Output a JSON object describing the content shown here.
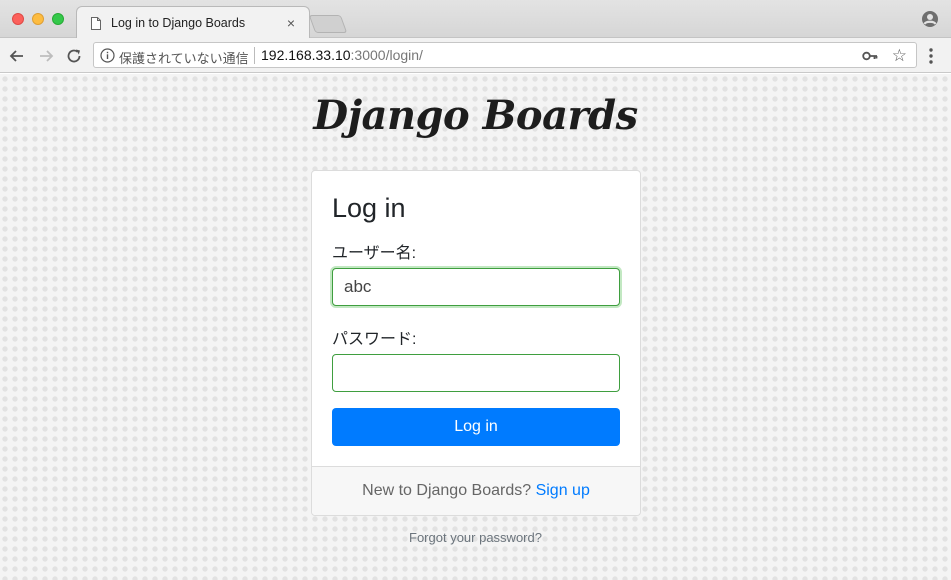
{
  "browser": {
    "tab_title": "Log in to Django Boards",
    "tab_close": "×",
    "security_text": "保護されていない通信",
    "url_host": "192.168.33.10",
    "url_rest": ":3000/login/",
    "star_glyph": "☆",
    "icons": [
      "back-icon",
      "forward-icon",
      "reload-icon",
      "info-icon",
      "key-icon",
      "star-icon",
      "menu-icon",
      "profile-icon",
      "document-icon"
    ]
  },
  "page": {
    "brand": "Django Boards",
    "form": {
      "title": "Log in",
      "username_label": "ユーザー名:",
      "username_value": "abc",
      "password_label": "パスワード:",
      "password_value": "",
      "submit_label": "Log in"
    },
    "footer": {
      "prompt": "New to Django Boards?",
      "signup_label": "Sign up"
    },
    "forgot_label": "Forgot your password?"
  },
  "colors": {
    "accent": "#007bff",
    "input_border": "#3f9e3f"
  }
}
